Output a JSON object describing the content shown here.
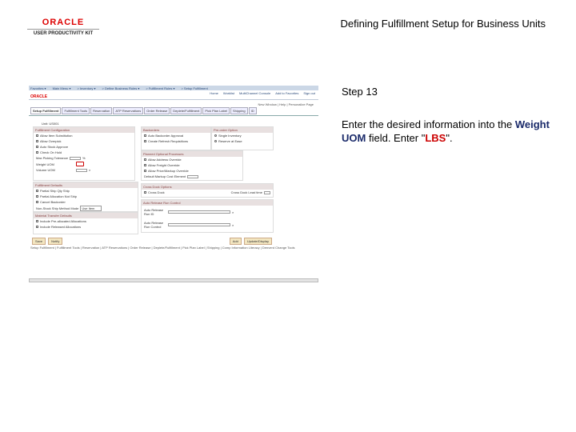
{
  "logo": {
    "brand": "ORACLE",
    "product": "USER PRODUCTIVITY KIT"
  },
  "title": "Defining Fulfillment Setup for Business Units",
  "instruction": {
    "step": "Step 13",
    "pre": "Enter the desired information into the",
    "field": "Weight UOM",
    "mid": "field. Enter \"",
    "value": "LBS",
    "post": "\"."
  },
  "app": {
    "nav": [
      "Favorites ▾",
      "Main Menu ▾",
      "> Inventory ▾",
      "> Define Business Rules ▾",
      "> Fulfillment Rules ▾",
      "> Setup Fulfillment"
    ],
    "brand": "ORACLE",
    "header_links": [
      "Home",
      "Worklist",
      "MultiChannel Console",
      "Add to Favorites",
      "Sign out"
    ],
    "tools": "New Window | Help | Personalize Page",
    "tabs": [
      "Setup Fulfillment",
      "Fulfillment Tools",
      "Reservation",
      "ATP Reservations",
      "Order Release",
      "Deplete/Fulfillment",
      "Pick Plan Label",
      "Shipping",
      "ID"
    ],
    "unit": "Unit: US001",
    "fulfillment_config": {
      "title": "Fulfillment Configuration",
      "items": [
        "Allow Item Substitution",
        "Allow Overpick",
        "Auto Stock Approve",
        "Check On Hold"
      ],
      "tolerance": "Max Picking Tolerance",
      "pct": "%",
      "weight": "Weight UOM",
      "volume": "Volume UOM"
    },
    "backorders": {
      "title": "Backorders",
      "items": [
        "Auto Backorder Approval",
        "Create Refresh Requisitions"
      ]
    },
    "preorder": {
      "title": "Pre-order Option",
      "items": [
        "Single Inventory",
        "Reserve at Ease"
      ]
    },
    "optional": {
      "title": "Planned Optional Processes",
      "items": [
        "Allow Address Override",
        "Allow Freight Override",
        "Allow Price/Markup Override"
      ],
      "markup": "Default Markup Cost Element"
    },
    "fulfill_defaults": {
      "title": "Fulfillment Defaults",
      "items": [
        "Partial Ship Qty Ship",
        "Partial Allocation Not Ship",
        "Cancel Backorder"
      ],
      "mode_label": "Non-Stock Ship Method Mode",
      "mode_value": "Use Item"
    },
    "material": {
      "title": "Material Transfer Defaults",
      "items": [
        "Include Pre-allocated Allocations",
        "Include Released Allocations"
      ]
    },
    "crossdock": {
      "title": "Cross Dock Options",
      "item": "Cross Dock",
      "lead": "Cross Dock Lead time"
    },
    "autorelease": {
      "title": "Auto Release Run Control",
      "id": "Auto Release Run ID",
      "ctrl": "Auto Release Run Control"
    },
    "buttons": {
      "save": "Save",
      "notify": "Notify",
      "add": "Add",
      "update": "Update/Display"
    },
    "footer": "Setup Fulfillment | Fulfillment Tools | Reservation | ATP Reservations | Order Release | Deplete/Fulfillment | Pick Plan Label | Shipping | Comp Information Literacy | Denverd Change Tools"
  }
}
